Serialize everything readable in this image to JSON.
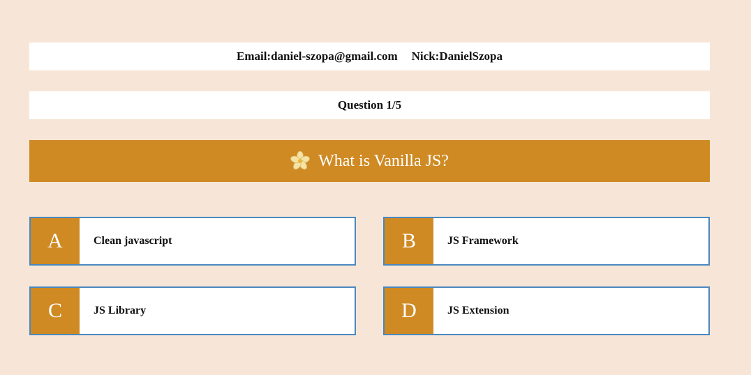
{
  "user": {
    "email_text": "Email:daniel-szopa@gmail.com",
    "nick_text": "Nick:DanielSzopa"
  },
  "progress": {
    "label": "Question 1/5"
  },
  "question": {
    "icon": "vanilla-flower-icon",
    "text": "What is Vanilla JS?"
  },
  "answers": [
    {
      "letter": "A",
      "text": "Clean javascript"
    },
    {
      "letter": "B",
      "text": "JS Framework"
    },
    {
      "letter": "C",
      "text": "JS Library"
    },
    {
      "letter": "D",
      "text": "JS Extension"
    }
  ],
  "colors": {
    "background": "#f7e6d7",
    "accent": "#cf8a23",
    "answer_border": "#4a88c0",
    "panel": "#ffffff"
  }
}
